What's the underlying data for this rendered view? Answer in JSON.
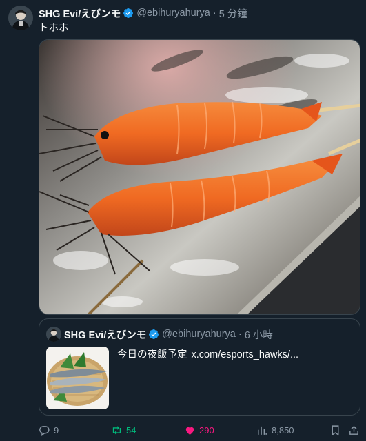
{
  "tweet": {
    "author_name": "SHG Evi/えびンモ",
    "handle": "@ebihuryahurya",
    "time": "5 分鐘",
    "text": "トホホ"
  },
  "quote": {
    "author_name": "SHG Evi/えびンモ",
    "handle": "@ebihuryahurya",
    "time": "6 小時",
    "text": "今日の夜飯予定",
    "link": "x.com/esports_hawks/..."
  },
  "actions": {
    "replies": "9",
    "retweets": "54",
    "likes": "290",
    "views": "8,850"
  },
  "icons": [
    "verified-badge-icon",
    "reply-icon",
    "retweet-icon",
    "heart-icon",
    "views-icon",
    "bookmark-icon",
    "share-icon"
  ],
  "colors": {
    "background": "#15202b",
    "muted_text": "#8b98a5",
    "verified": "#1d9bf0",
    "retweet_active": "#00ba7c",
    "like_active": "#f91880"
  }
}
